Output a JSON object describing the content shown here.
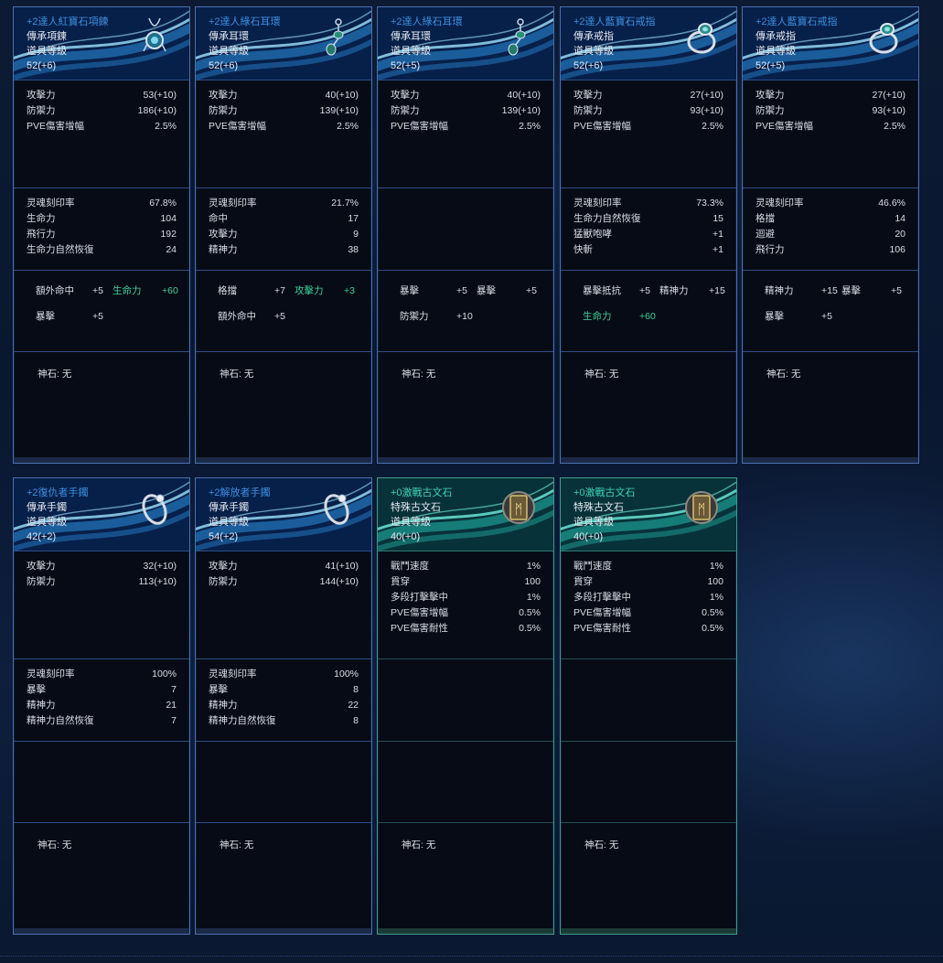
{
  "cards": [
    {
      "name": "+2達人紅寶石項鍊",
      "type": "傳承項鍊",
      "level_label": "道具等級",
      "level": "52(+6)",
      "icon": "necklace-icon",
      "base": [
        [
          "攻擊力",
          "53(+10)"
        ],
        [
          "防禦力",
          "186(+10)"
        ],
        [
          "PVE傷害增幅",
          "2.5%"
        ]
      ],
      "extra": [
        [
          "灵魂刻印率",
          "67.8%"
        ],
        [
          "生命力",
          "104"
        ],
        [
          "飛行力",
          "192"
        ],
        [
          "生命力自然恢復",
          "24"
        ]
      ],
      "gems": [
        [
          [
            "額外命中",
            "+5",
            false
          ],
          [
            "生命力",
            "+60",
            true
          ]
        ],
        [
          [
            "暴擊",
            "+5",
            false
          ]
        ]
      ],
      "stone": "神石: 无"
    },
    {
      "name": "+2達人綠石耳環",
      "type": "傳承耳環",
      "level_label": "道具等級",
      "level": "52(+6)",
      "icon": "earring-icon",
      "base": [
        [
          "攻擊力",
          "40(+10)"
        ],
        [
          "防禦力",
          "139(+10)"
        ],
        [
          "PVE傷害增幅",
          "2.5%"
        ]
      ],
      "extra": [
        [
          "灵魂刻印率",
          "21.7%"
        ],
        [
          "命中",
          "17"
        ],
        [
          "攻擊力",
          "9"
        ],
        [
          "精神力",
          "38"
        ]
      ],
      "gems": [
        [
          [
            "格擋",
            "+7",
            false
          ],
          [
            "攻擊力",
            "+3",
            true
          ]
        ],
        [
          [
            "額外命中",
            "+5",
            false
          ]
        ]
      ],
      "stone": "神石: 无"
    },
    {
      "name": "+2達人綠石耳環",
      "type": "傳承耳環",
      "level_label": "道具等級",
      "level": "52(+5)",
      "icon": "earring-icon",
      "base": [
        [
          "攻擊力",
          "40(+10)"
        ],
        [
          "防禦力",
          "139(+10)"
        ],
        [
          "PVE傷害增幅",
          "2.5%"
        ]
      ],
      "extra": [],
      "gems": [
        [
          [
            "暴擊",
            "+5",
            false
          ],
          [
            "暴擊",
            "+5",
            false
          ]
        ],
        [
          [
            "防禦力",
            "+10",
            false
          ]
        ]
      ],
      "stone": "神石: 无"
    },
    {
      "name": "+2達人藍寶石戒指",
      "type": "傳承戒指",
      "level_label": "道具等級",
      "level": "52(+6)",
      "icon": "ring-icon",
      "base": [
        [
          "攻擊力",
          "27(+10)"
        ],
        [
          "防禦力",
          "93(+10)"
        ],
        [
          "PVE傷害增幅",
          "2.5%"
        ]
      ],
      "extra": [
        [
          "灵魂刻印率",
          "73.3%"
        ],
        [
          "生命力自然恢復",
          "15"
        ],
        [
          "猛獸咆哮",
          "+1"
        ],
        [
          "快斬",
          "+1"
        ]
      ],
      "gems": [
        [
          [
            "暴擊抵抗",
            "+5",
            false
          ],
          [
            "精神力",
            "+15",
            false
          ]
        ],
        [
          [
            "生命力",
            "+60",
            true
          ]
        ]
      ],
      "stone": "神石: 无"
    },
    {
      "name": "+2達人藍寶石戒指",
      "type": "傳承戒指",
      "level_label": "道具等級",
      "level": "52(+5)",
      "icon": "ring-icon",
      "base": [
        [
          "攻擊力",
          "27(+10)"
        ],
        [
          "防禦力",
          "93(+10)"
        ],
        [
          "PVE傷害增幅",
          "2.5%"
        ]
      ],
      "extra": [
        [
          "灵魂刻印率",
          "46.6%"
        ],
        [
          "格擋",
          "14"
        ],
        [
          "迴避",
          "20"
        ],
        [
          "飛行力",
          "106"
        ]
      ],
      "gems": [
        [
          [
            "精神力",
            "+15",
            false
          ],
          [
            "暴擊",
            "+5",
            false
          ]
        ],
        [
          [
            "暴擊",
            "+5",
            false
          ]
        ]
      ],
      "stone": "神石: 无"
    },
    {
      "name": "+2復仇者手鐲",
      "type": "傳承手鐲",
      "level_label": "道具等級",
      "level": "42(+2)",
      "icon": "bracelet-icon",
      "base": [
        [
          "攻擊力",
          "32(+10)"
        ],
        [
          "防禦力",
          "113(+10)"
        ]
      ],
      "extra": [
        [
          "灵魂刻印率",
          "100%"
        ],
        [
          "暴擊",
          "7"
        ],
        [
          "精神力",
          "21"
        ],
        [
          "精神力自然恢復",
          "7"
        ]
      ],
      "gems": [],
      "stone": "神石: 无"
    },
    {
      "name": "+2解放者手鐲",
      "type": "傳承手鐲",
      "level_label": "道具等級",
      "level": "54(+2)",
      "icon": "bracelet-icon",
      "base": [
        [
          "攻擊力",
          "41(+10)"
        ],
        [
          "防禦力",
          "144(+10)"
        ]
      ],
      "extra": [
        [
          "灵魂刻印率",
          "100%"
        ],
        [
          "暴擊",
          "8"
        ],
        [
          "精神力",
          "22"
        ],
        [
          "精神力自然恢復",
          "8"
        ]
      ],
      "gems": [],
      "stone": "神石: 无"
    },
    {
      "name": "+0激戰古文石",
      "type": "特殊古文石",
      "level_label": "道具等級",
      "level": "40(+0)",
      "icon": "rune-stone-icon",
      "rune": true,
      "base": [
        [
          "戰鬥速度",
          "1%"
        ],
        [
          "貫穿",
          "100"
        ],
        [
          "多段打擊擊中",
          "1%"
        ],
        [
          "PVE傷害增幅",
          "0.5%"
        ],
        [
          "PVE傷害耐性",
          "0.5%"
        ]
      ],
      "extra": [],
      "gems": [],
      "stone": "神石: 无"
    },
    {
      "name": "+0激戰古文石",
      "type": "特殊古文石",
      "level_label": "道具等級",
      "level": "40(+0)",
      "icon": "rune-stone-icon",
      "rune": true,
      "base": [
        [
          "戰鬥速度",
          "1%"
        ],
        [
          "貫穿",
          "100"
        ],
        [
          "多段打擊擊中",
          "1%"
        ],
        [
          "PVE傷害增幅",
          "0.5%"
        ],
        [
          "PVE傷害耐性",
          "0.5%"
        ]
      ],
      "extra": [],
      "gems": [],
      "stone": "神石: 无"
    }
  ]
}
